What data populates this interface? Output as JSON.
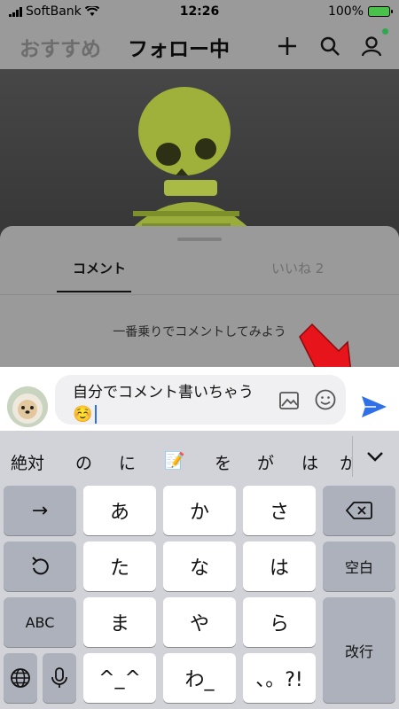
{
  "status_bar": {
    "carrier": "SoftBank",
    "time": "12:26",
    "battery": "100%"
  },
  "header": {
    "tab_recommend": "おすすめ",
    "tab_following": "フォロー中",
    "icons": [
      "plus-icon",
      "search-icon",
      "profile-icon"
    ]
  },
  "sheet": {
    "tab_comment": "コメント",
    "tab_likes": "いいね 2",
    "empty_message": "一番乗りでコメントしてみよう"
  },
  "comment_input": {
    "line1": "自分でコメント書いちゃう",
    "line2_emoji": "☺️"
  },
  "keyboard": {
    "candidates": [
      "絶対",
      "の",
      "に",
      "📝",
      "を",
      "が",
      "は",
      "か"
    ],
    "rows": [
      [
        "→",
        "あ",
        "か",
        "さ",
        "⌫"
      ],
      [
        "↺",
        "た",
        "な",
        "は",
        "空白"
      ],
      [
        "ABC",
        "ま",
        "や",
        "ら",
        "改行"
      ],
      [
        "🌐",
        "🎤",
        "^^",
        "わ_",
        "、。?!"
      ]
    ],
    "key_labels": {
      "arrow": "→",
      "a": "あ",
      "ka": "か",
      "sa": "さ",
      "ta": "た",
      "na": "な",
      "ha": "は",
      "space": "空白",
      "abc": "ABC",
      "ma": "ま",
      "ya": "や",
      "ra": "ら",
      "return": "改行",
      "kaomoji": "^_^",
      "wa": "わ_",
      "punct": "、。?!"
    }
  },
  "colors": {
    "send_blue": "#2f6fe8",
    "arrow_red": "#e8141b",
    "battery_green": "#49c14a"
  }
}
